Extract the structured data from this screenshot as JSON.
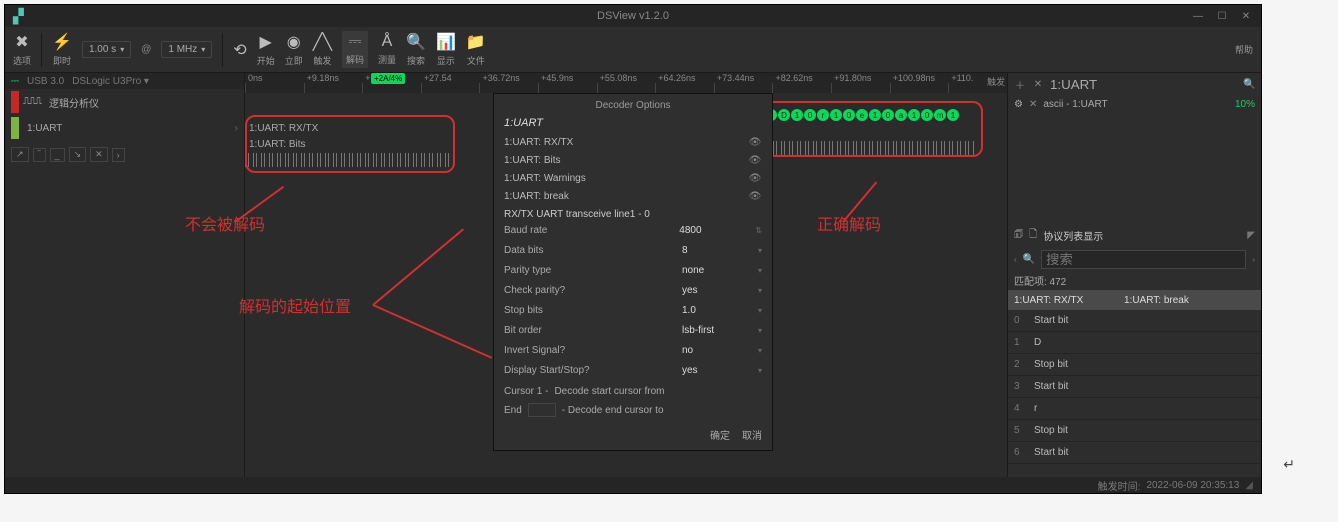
{
  "window": {
    "title": "DSView v1.2.0"
  },
  "devbar": {
    "version": "USB 3.0",
    "device": "DSLogic U3Pro ▾"
  },
  "toolbar": {
    "options": "选项",
    "mode": "即时",
    "sample_duration": "1.00 s",
    "sample_rate": "1 MHz",
    "start": "开始",
    "stop": "立即",
    "trigger": "触发",
    "decode": "解码",
    "measure": "测量",
    "search": "搜索",
    "display": "显示",
    "file": "文件",
    "help": "帮助"
  },
  "ruler": {
    "ticks": [
      "0ns",
      "+9.18ns",
      "+18.36ns",
      "+27.54",
      "+36.72ns",
      "+45.9ns",
      "+55.08ns",
      "+64.26ns",
      "+73.44ns",
      "+82.62ns",
      "+91.80ns",
      "+100.98ns",
      "+110."
    ],
    "end_label": "触发",
    "cursor": "+2A/4%"
  },
  "channels": {
    "ch0": "逻辑分析仪",
    "dec1": "1:UART"
  },
  "decrows": {
    "rx": "1:UART: RX/TX",
    "bits": "1:UART: Bits"
  },
  "callouts": {
    "not_decoded": "不会被解码",
    "decode_start": "解码的起始位置",
    "correct": "正确解码"
  },
  "decoder": {
    "header": "Decoder Options",
    "title": "1:UART",
    "rows": [
      "1:UART: RX/TX",
      "1:UART: Bits",
      "1:UART: Warnings",
      "1:UART: break"
    ],
    "sig": "RX/TX  UART transceive line1 - 0",
    "params": {
      "baud": {
        "label": "Baud rate",
        "value": "4800"
      },
      "databits": {
        "label": "Data bits",
        "value": "8"
      },
      "parity": {
        "label": "Parity type",
        "value": "none"
      },
      "chkpar": {
        "label": "Check parity?",
        "value": "yes"
      },
      "stop": {
        "label": "Stop bits",
        "value": "1.0"
      },
      "order": {
        "label": "Bit order",
        "value": "lsb-first"
      },
      "invert": {
        "label": "Invert Signal?",
        "value": "no"
      },
      "dispss": {
        "label": "Display Start/Stop?",
        "value": "yes"
      }
    },
    "range": {
      "from_lbl": "Cursor 1 -",
      "from_txt": "Decode start cursor from",
      "to_lbl": "End",
      "to_txt": "- Decode end cursor to"
    },
    "ok": "确定",
    "cancel": "取消"
  },
  "rightpanel": {
    "protocol_search": "1:UART",
    "ascii_line": "ascii - 1:UART",
    "ascii_val": "10%",
    "list_title": "协议列表显示",
    "search_ph": "搜索",
    "match": "匹配项: 472",
    "col1": "1:UART: RX/TX",
    "col2": "1:UART: break",
    "rows": [
      {
        "i": "0",
        "v": "Start bit"
      },
      {
        "i": "1",
        "v": "D"
      },
      {
        "i": "2",
        "v": "Stop bit"
      },
      {
        "i": "3",
        "v": "Start bit"
      },
      {
        "i": "4",
        "v": "r"
      },
      {
        "i": "5",
        "v": "Stop bit"
      },
      {
        "i": "6",
        "v": "Start bit"
      }
    ]
  },
  "footer": {
    "trigger_time_label": "触发时间:",
    "trigger_time": "2022-06-09 20:35:13"
  }
}
